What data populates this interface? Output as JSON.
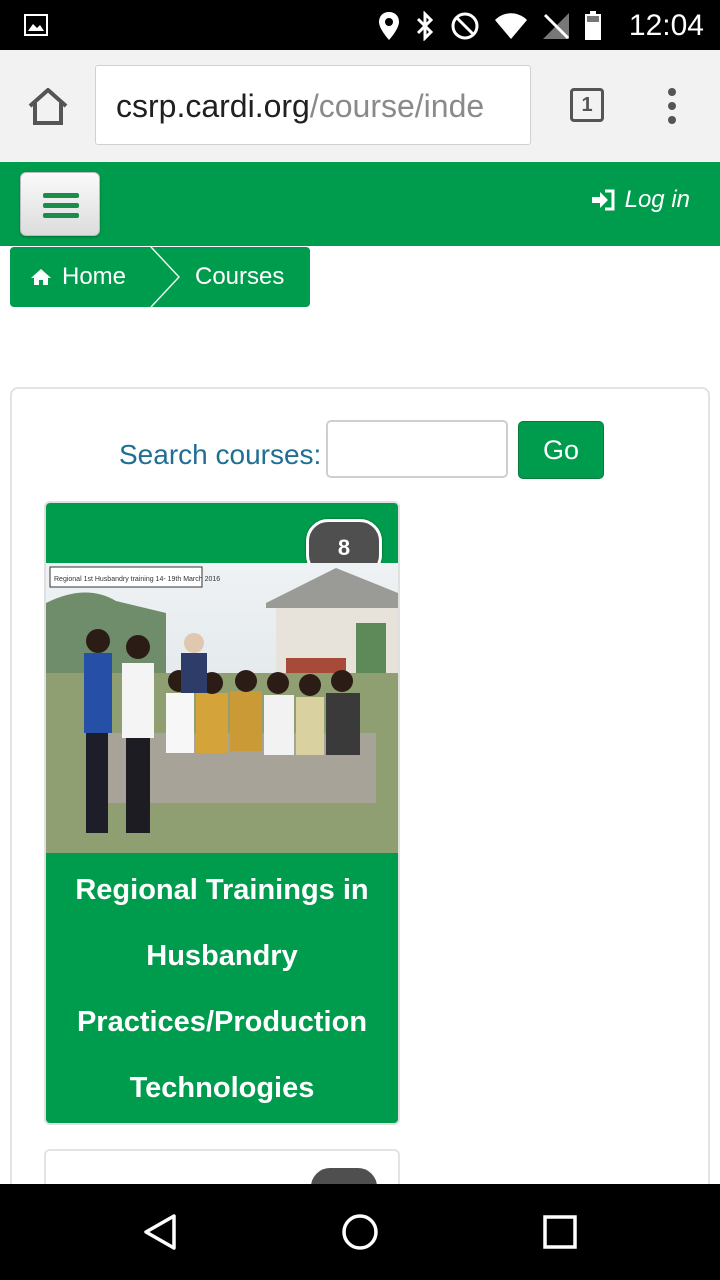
{
  "status_bar": {
    "time": "12:04",
    "icons": [
      "gallery-icon",
      "location-icon",
      "bluetooth-icon",
      "do-not-disturb-icon",
      "wifi-icon",
      "no-signal-icon",
      "battery-icon"
    ]
  },
  "browser": {
    "url_host": "csrp.cardi.org",
    "url_path": "/course/inde",
    "tab_count": "1",
    "icons": [
      "home-icon",
      "tabs-icon",
      "overflow-menu-icon"
    ]
  },
  "navbar": {
    "menu_icon": "hamburger-icon",
    "login_label": "Log in",
    "login_icon": "sign-in-icon",
    "color": "#009c4d"
  },
  "breadcrumb": {
    "items": [
      {
        "label": "Home",
        "icon": "home-icon"
      },
      {
        "label": "Courses"
      }
    ]
  },
  "search": {
    "label": "Search courses:",
    "value": "",
    "button_label": "Go"
  },
  "courses": [
    {
      "title": "Regional Trainings in Husbandry Practices/Production Technologies",
      "count": "8",
      "image_caption": "Regional 1st Husbandry training 14- 19th March 2016"
    }
  ],
  "android_nav": {
    "icons": [
      "back-icon",
      "home-circle-icon",
      "recents-icon"
    ]
  },
  "colors": {
    "brand_green": "#009c4d",
    "search_label": "#1f6f94",
    "badge": "#4f4f4f"
  }
}
